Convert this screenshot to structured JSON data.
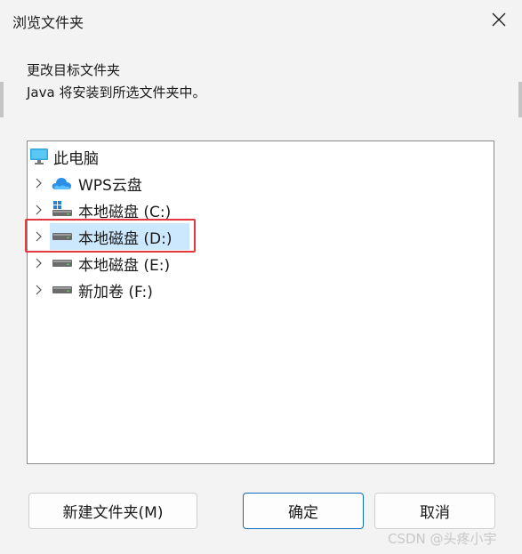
{
  "dialog": {
    "title": "浏览文件夹",
    "description_line1": "更改目标文件夹",
    "description_line2": "Java 将安装到所选文件夹中。"
  },
  "tree": {
    "root": {
      "label": "此电脑",
      "icon": "monitor-icon"
    },
    "items": [
      {
        "label": "WPS云盘",
        "icon": "cloud-icon",
        "selected": false
      },
      {
        "label": "本地磁盘 (C:)",
        "icon": "system-drive-icon",
        "selected": false
      },
      {
        "label": "本地磁盘 (D:)",
        "icon": "drive-icon",
        "selected": true
      },
      {
        "label": "本地磁盘 (E:)",
        "icon": "drive-icon",
        "selected": false
      },
      {
        "label": "新加卷 (F:)",
        "icon": "drive-icon",
        "selected": false
      }
    ]
  },
  "buttons": {
    "new_folder": "新建文件夹(M)",
    "ok": "确定",
    "cancel": "取消"
  },
  "watermark": "CSDN @头疼小宇",
  "colors": {
    "selection": "#cce8ff",
    "highlight_box": "#e0393e",
    "primary_border": "#0f6cbd"
  }
}
